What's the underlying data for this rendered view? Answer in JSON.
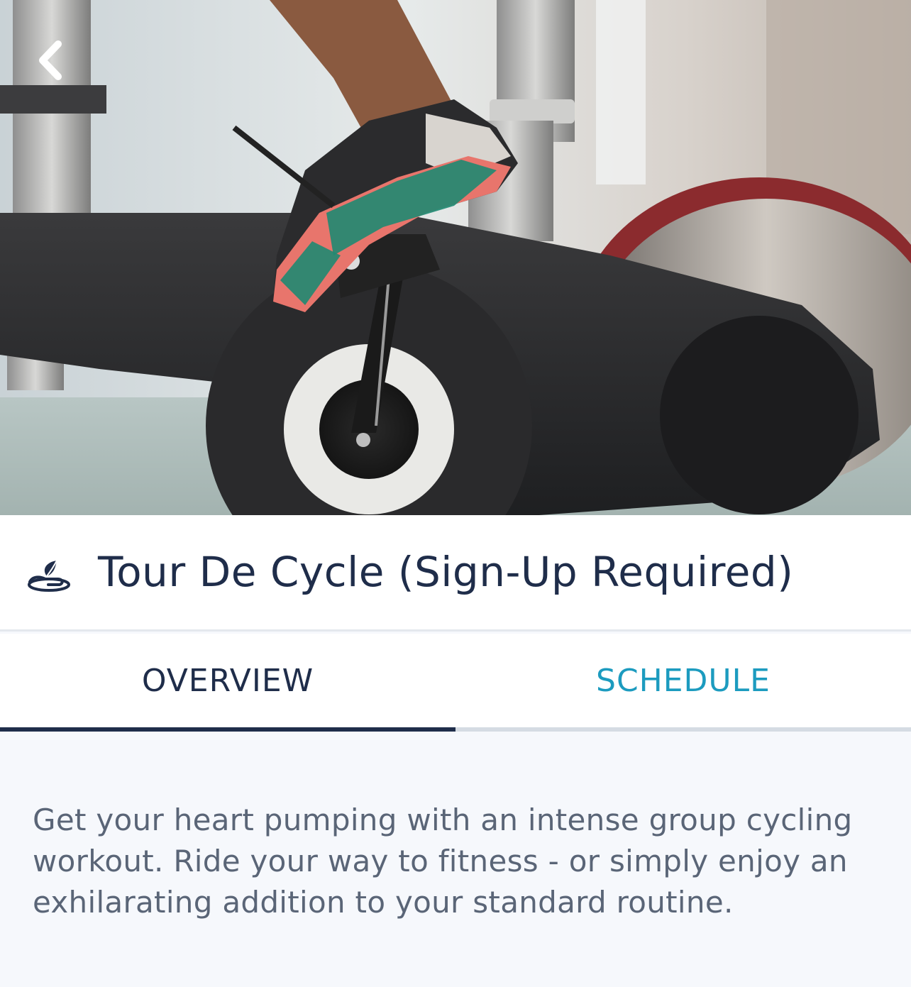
{
  "hero": {
    "image": "indoor-cycling-bike-photo",
    "back_icon": "chevron-left-icon"
  },
  "class": {
    "icon": "leaf-hand-icon",
    "title": "Tour De Cycle (Sign-Up Required)"
  },
  "tabs": [
    {
      "label": "OVERVIEW",
      "active": true
    },
    {
      "label": "SCHEDULE",
      "active": false
    }
  ],
  "overview": {
    "description": "Get your heart pumping with an intense group cycling workout. Ride your way to fitness - or simply enjoy an exhilarating addition to your standard routine."
  },
  "colors": {
    "title_text": "#1f2d4a",
    "active_tab": "#1f2d4a",
    "inactive_tab": "#1c9bbf",
    "body_text": "#5a6577",
    "content_bg": "#f6f8fc"
  }
}
